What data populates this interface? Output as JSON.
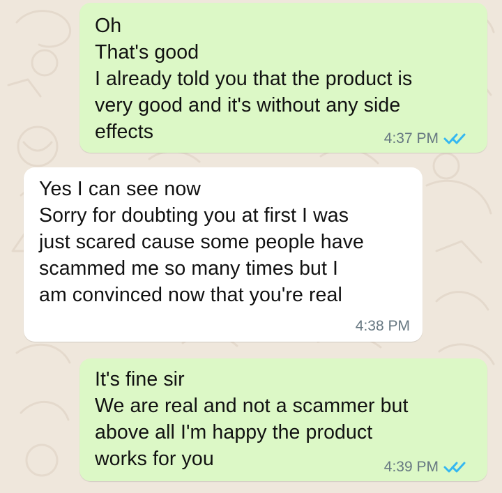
{
  "chat": {
    "messages": [
      {
        "direction": "outgoing",
        "lines": [
          "Oh",
          "That's good",
          "I already told you that the product is",
          "very good and it's without any side",
          "effects"
        ],
        "time": "4:37 PM",
        "status_icon": "double-check-icon"
      },
      {
        "direction": "incoming",
        "lines": [
          "Yes I can see now",
          "Sorry for doubting you at first I was",
          "just scared cause some people have",
          "scammed me so many times but I",
          "am convinced now that you're real"
        ],
        "time": "4:38 PM"
      },
      {
        "direction": "outgoing",
        "lines": [
          "It's fine sir",
          "We are real and not a scammer but",
          "above all I'm happy the product",
          "works for you"
        ],
        "time": "4:39 PM",
        "status_icon": "double-check-icon"
      }
    ]
  },
  "colors": {
    "background": "#efe7dc",
    "outgoing_bubble": "#dcf8c6",
    "incoming_bubble": "#ffffff",
    "read_receipt": "#34b7f1",
    "timestamp": "#667781",
    "text": "#111111"
  }
}
